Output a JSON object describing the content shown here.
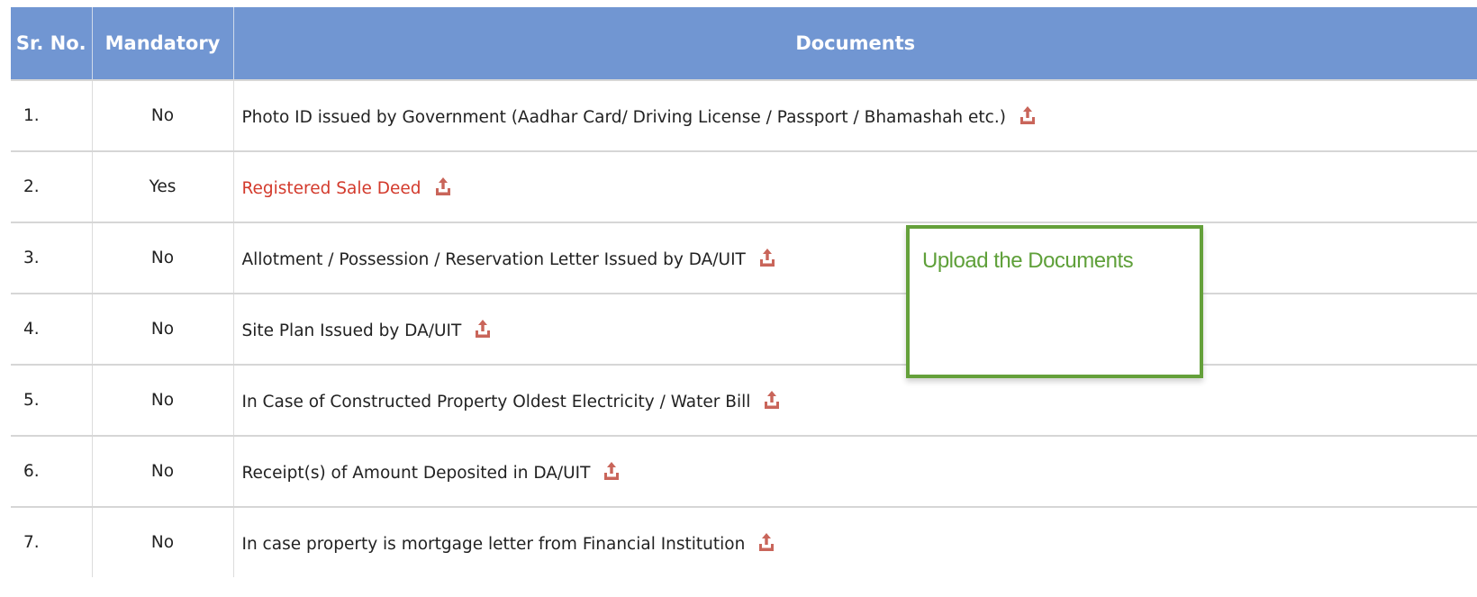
{
  "table": {
    "headers": {
      "sr_no": "Sr. No.",
      "mandatory": "Mandatory",
      "documents": "Documents"
    },
    "rows": [
      {
        "sr": "1.",
        "mandatory": "No",
        "document": "Photo ID issued by Government (Aadhar Card/ Driving License / Passport / Bhamashah etc.)"
      },
      {
        "sr": "2.",
        "mandatory": "Yes",
        "document": "Registered Sale Deed"
      },
      {
        "sr": "3.",
        "mandatory": "No",
        "document": "Allotment / Possession / Reservation Letter Issued by DA/UIT"
      },
      {
        "sr": "4.",
        "mandatory": "No",
        "document": "Site Plan Issued by DA/UIT"
      },
      {
        "sr": "5.",
        "mandatory": "No",
        "document": "In Case of Constructed Property Oldest Electricity / Water Bill"
      },
      {
        "sr": "6.",
        "mandatory": "No",
        "document": "Receipt(s) of Amount Deposited in DA/UIT"
      },
      {
        "sr": "7.",
        "mandatory": "No",
        "document": "In case property is mortgage letter from Financial Institution"
      }
    ]
  },
  "tooltip": {
    "text": "Upload the Documents"
  },
  "icons": {
    "upload": "upload-icon"
  },
  "colors": {
    "header_bg": "#7196d2",
    "required_text": "#d33a2c",
    "upload_icon": "#c9655a",
    "tooltip_border": "#64a03a",
    "tooltip_text": "#5fa03a"
  }
}
